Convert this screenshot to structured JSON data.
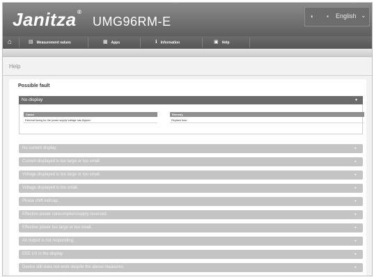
{
  "header": {
    "brand": "Janitza",
    "brand_mark": "®",
    "model": "UMG96RM-E",
    "language": {
      "icon": "globe-icon",
      "flag": "flag-icon",
      "label": "English",
      "chevron": "chevron-down-icon"
    }
  },
  "nav": {
    "home_icon": "home-icon",
    "items": [
      {
        "label": "Measurement values",
        "icon": "table-icon"
      },
      {
        "label": "Apps",
        "icon": "grid-icon"
      },
      {
        "label": "Information",
        "icon": "info-icon"
      },
      {
        "label": "Help",
        "icon": "book-icon"
      }
    ]
  },
  "breadcrumb": "Help",
  "section_title": "Possible fault",
  "open_item": {
    "title": "No display",
    "columns": [
      {
        "header": "Cause",
        "value": "External fusing for the power supply voltage has tripped."
      },
      {
        "header": "Remedy",
        "value": "Replace fuse."
      }
    ]
  },
  "faults": [
    "No current display",
    "Current displayed is too large or too small.",
    "Voltage displayed is too large or too small.",
    "Voltage displayed is too small.",
    "Phase shift ind/cap.",
    "Effective power consumption/supply reversed.",
    "Effective power too large or too small.",
    "An output is not responding.",
    "EEE U/I in the display",
    "Device still does not work despite the above measures."
  ],
  "colors": {
    "header": "#6f6f6f",
    "accordion_open": "#6b6b6b",
    "accordion_closed": "#c4c4c4"
  }
}
